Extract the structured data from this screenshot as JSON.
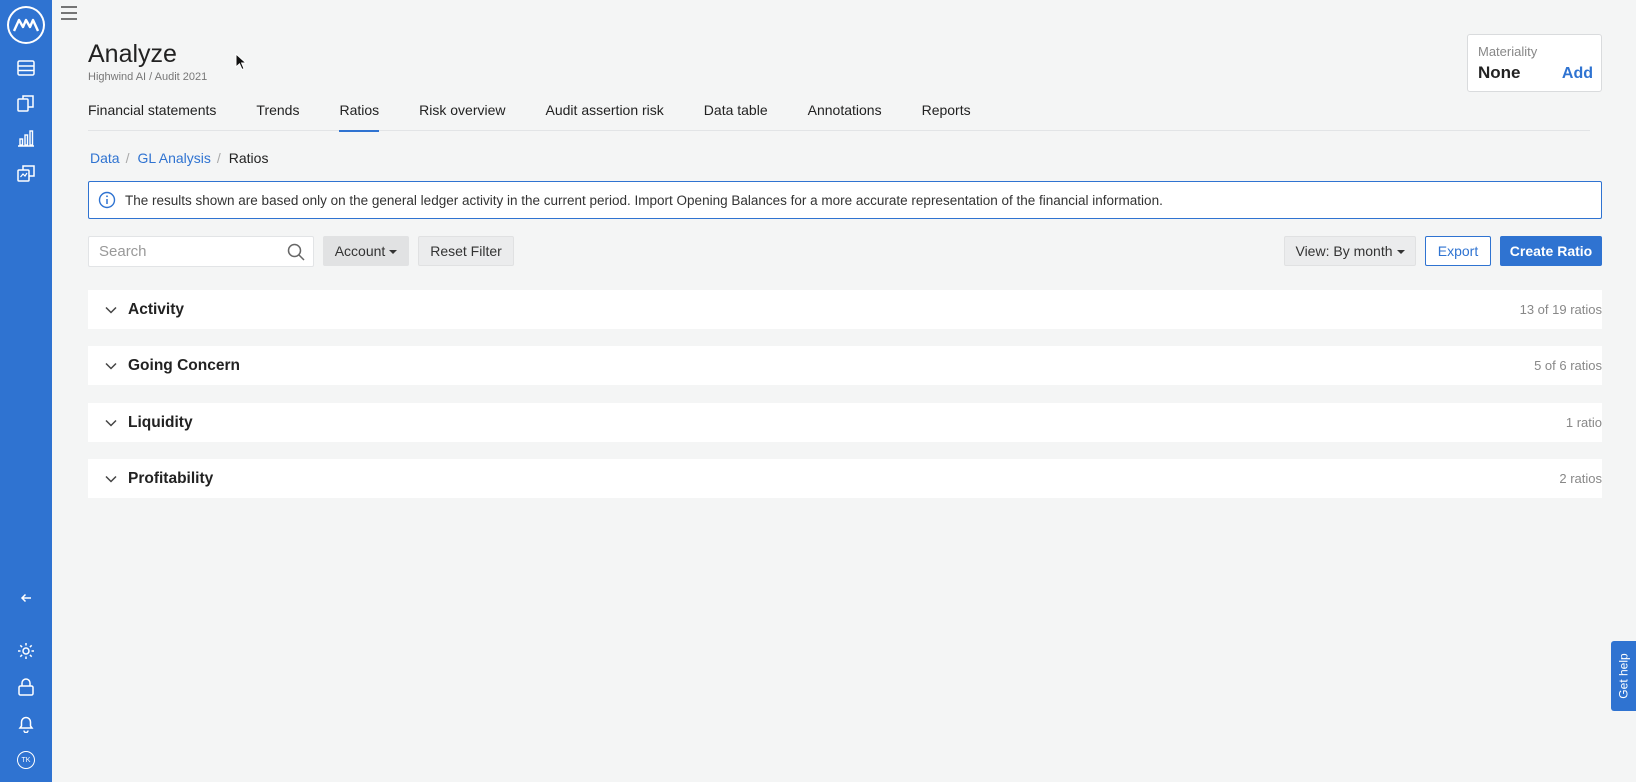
{
  "header": {
    "title": "Analyze",
    "subtitle": "Highwind AI / Audit 2021"
  },
  "materiality": {
    "label": "Materiality",
    "value": "None",
    "add_label": "Add"
  },
  "tabs": [
    {
      "label": "Financial statements"
    },
    {
      "label": "Trends"
    },
    {
      "label": "Ratios",
      "active": true
    },
    {
      "label": "Risk overview"
    },
    {
      "label": "Audit assertion risk"
    },
    {
      "label": "Data table"
    },
    {
      "label": "Annotations"
    },
    {
      "label": "Reports"
    }
  ],
  "breadcrumb": [
    {
      "label": "Data"
    },
    {
      "label": "GL Analysis"
    },
    {
      "label": "Ratios"
    }
  ],
  "info_banner": {
    "text": "The results shown are based only on the general ledger activity in the current period. Import Opening Balances for a more accurate representation of the financial information."
  },
  "toolbar": {
    "search_placeholder": "Search",
    "account_label": "Account",
    "reset_label": "Reset Filter",
    "view_label": "View: By month",
    "export_label": "Export",
    "create_label": "Create Ratio"
  },
  "groups": [
    {
      "title": "Activity",
      "count": "13 of 19 ratios"
    },
    {
      "title": "Going Concern",
      "count": "5 of 6 ratios"
    },
    {
      "title": "Liquidity",
      "count": "1 ratio"
    },
    {
      "title": "Profitability",
      "count": "2 ratios"
    }
  ],
  "help": {
    "label": "Get help"
  },
  "user": {
    "initials": "TK"
  },
  "colors": {
    "accent": "#2f73d1",
    "background": "#f4f5f5"
  }
}
